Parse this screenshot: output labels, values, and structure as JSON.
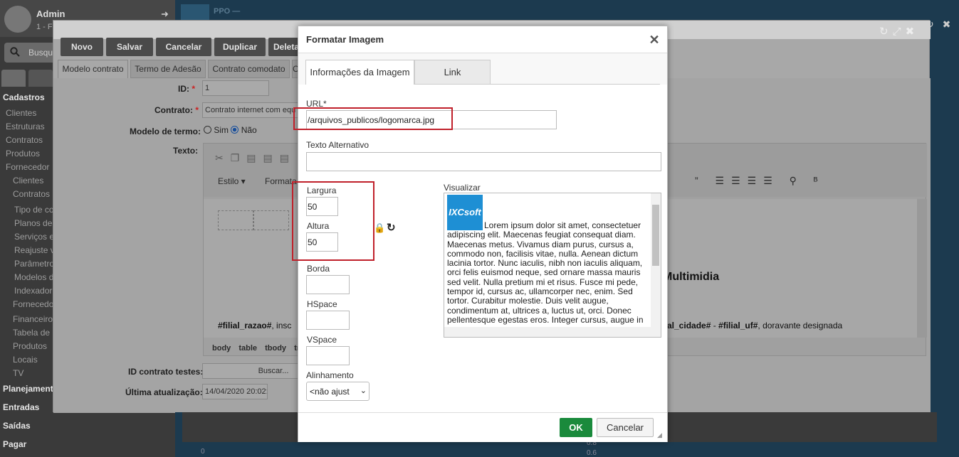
{
  "sidebar": {
    "user_name": "Admin",
    "user_sub": "1 - F",
    "search_placeholder": "Busqu",
    "items": [
      {
        "label": "Cadastros",
        "type": "header"
      },
      {
        "label": "Clientes",
        "type": "sub"
      },
      {
        "label": "Estruturas",
        "type": "sub"
      },
      {
        "label": "Contratos",
        "type": "sub"
      },
      {
        "label": "Produtos",
        "type": "sub"
      },
      {
        "label": "Fornecedor",
        "type": "sub"
      },
      {
        "label": "Clientes",
        "type": "folder"
      },
      {
        "label": "Contratos",
        "type": "folder"
      },
      {
        "label": "Tipo de co",
        "type": "sub2"
      },
      {
        "label": "Planos de v",
        "type": "sub2"
      },
      {
        "label": "Serviços e",
        "type": "sub2"
      },
      {
        "label": "Reajuste va",
        "type": "sub2"
      },
      {
        "label": "Parâmetros",
        "type": "sub2"
      },
      {
        "label": "Modelos d",
        "type": "sub2"
      },
      {
        "label": "Indexador",
        "type": "sub2"
      },
      {
        "label": "Fornecedor",
        "type": "folder"
      },
      {
        "label": "Financeiro",
        "type": "folder"
      },
      {
        "label": "Tabela de p",
        "type": "folder"
      },
      {
        "label": "Produtos",
        "type": "folder"
      },
      {
        "label": "Locais",
        "type": "folder"
      },
      {
        "label": "TV",
        "type": "folder"
      },
      {
        "label": "Planejamento",
        "type": "header"
      },
      {
        "label": "Entradas",
        "type": "header"
      },
      {
        "label": "Saídas",
        "type": "header"
      },
      {
        "label": "Pagar",
        "type": "header"
      }
    ]
  },
  "toolbar": {
    "novo": "Novo",
    "salvar": "Salvar",
    "cancelar": "Cancelar",
    "duplicar": "Duplicar",
    "deletar": "Deleta"
  },
  "tabs": [
    "Modelo contrato",
    "Termo de Adesão",
    "Contrato comodato",
    "Co"
  ],
  "form": {
    "id_label": "ID:",
    "id_value": "1",
    "contrato_label": "Contrato:",
    "contrato_value": "Contrato internet com equ",
    "modelo_label": "Modelo de termo:",
    "sim": "Sim",
    "nao": "Não",
    "texto_label": "Texto:",
    "id_testes_label": "ID contrato testes:",
    "id_testes_placeholder": "Buscar...",
    "ultima_label": "Última atualização:",
    "ultima_value": "14/04/2020 20:02:"
  },
  "editor": {
    "estilo": "Estilo",
    "formato": "Formata",
    "body_text_1": "#filial_razao#",
    "body_text_1b": ", insc",
    "body_text_2": "Multimidia",
    "body_text_3": "al_cidade#",
    "body_text_3b": " - ",
    "body_text_3c": "#filial_uf#",
    "body_text_3d": ", doravante designada",
    "path": [
      "body",
      "table",
      "tbody",
      "tr"
    ]
  },
  "dialog": {
    "title": "Formatar Imagem",
    "tab_info": "Informações da Imagem",
    "tab_link": "Link",
    "url_label": "URL*",
    "url_value": "/arquivos_publicos/logomarca.jpg",
    "alt_label": "Texto Alternativo",
    "alt_value": "",
    "largura_label": "Largura",
    "largura_value": "50",
    "altura_label": "Altura",
    "altura_value": "50",
    "borda_label": "Borda",
    "hspace_label": "HSpace",
    "vspace_label": "VSpace",
    "alinhamento_label": "Alinhamento",
    "alinhamento_value": "<não ajust",
    "preview_label": "Visualizar",
    "preview_logo": "IXCsoft",
    "preview_text": "Lorem ipsum dolor sit amet, consectetuer adipiscing elit. Maecenas feugiat consequat diam. Maecenas metus. Vivamus diam purus, cursus a, commodo non, facilisis vitae, nulla. Aenean dictum lacinia tortor. Nunc iaculis, nibh non iaculis aliquam, orci felis euismod neque, sed ornare massa mauris sed velit. Nulla pretium mi et risus. Fusce mi pede, tempor id, cursus ac, ullamcorper nec, enim. Sed tortor. Curabitur molestie. Duis velit augue, condimentum at, ultrices a, luctus ut, orci. Donec pellentesque egestas eros. Integer cursus, augue in",
    "ok": "OK",
    "cancel": "Cancelar"
  },
  "background": {
    "header_text": "PPO —",
    "bottom_left": "0",
    "bottom_right_1": "0.8",
    "bottom_right_2": "0.6"
  }
}
